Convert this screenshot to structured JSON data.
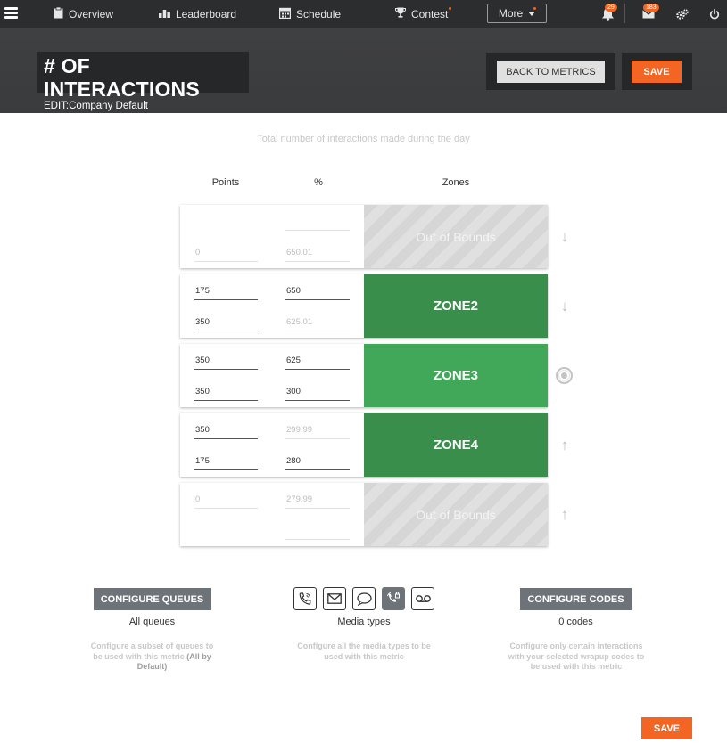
{
  "nav": {
    "items": [
      {
        "label": "Overview",
        "icon": "clipboard-icon"
      },
      {
        "label": "Leaderboard",
        "icon": "bar-chart-icon"
      },
      {
        "label": "Schedule",
        "icon": "calendar-icon"
      },
      {
        "label": "Contest",
        "icon": "trophy-icon"
      }
    ],
    "more_label": "More",
    "notifications_count": "29",
    "messages_count": "183"
  },
  "header": {
    "title": "# OF INTERACTIONS",
    "subtitle": "EDIT:Company Default",
    "back_label": "BACK TO METRICS",
    "save_label": "SAVE"
  },
  "description": "Total number of interactions made during the day",
  "columns": {
    "points": "Points",
    "percent": "%",
    "zones": "Zones"
  },
  "rows": [
    {
      "p1": "",
      "p2": "0",
      "pct1": "",
      "pct2": "650.01",
      "zone": "Out of Bounds",
      "style": "oob"
    },
    {
      "p1": "175",
      "p2": "350",
      "pct1": "650",
      "pct2": "625.01",
      "zone": "ZONE2",
      "style": "dark"
    },
    {
      "p1": "350",
      "p2": "350",
      "pct1": "625",
      "pct2": "300",
      "zone": "ZONE3",
      "style": "light"
    },
    {
      "p1": "350",
      "p2": "175",
      "pct1": "299.99",
      "pct2": "280",
      "zone": "ZONE4",
      "style": "dark"
    },
    {
      "p1": "0",
      "p2": "",
      "pct1": "279.99",
      "pct2": "",
      "zone": "Out of Bounds",
      "style": "oob"
    }
  ],
  "config": {
    "queues_button": "CONFIGURE QUEUES",
    "queues_label": "All  queues",
    "queues_desc": "Configure a subset of queues to be used with this metric",
    "queues_desc_bold": "(All by Default)",
    "media_label": "Media types",
    "media_desc": "Configure all the media types to be used with this metric",
    "media_icons": [
      "phone-icon",
      "email-icon",
      "chat-icon",
      "callback-icon",
      "voicemail-icon"
    ],
    "codes_button": "CONFIGURE CODES",
    "codes_label": "0 codes",
    "codes_desc": "Configure only certain interactions with your selected wrapup codes to be used with this metric"
  },
  "footer": {
    "save_label": "SAVE"
  },
  "colors": {
    "accent": "#f26522",
    "zone_dark": "#3a8e4c",
    "zone_light": "#41a859",
    "nav_bg": "#2c2d2f"
  }
}
